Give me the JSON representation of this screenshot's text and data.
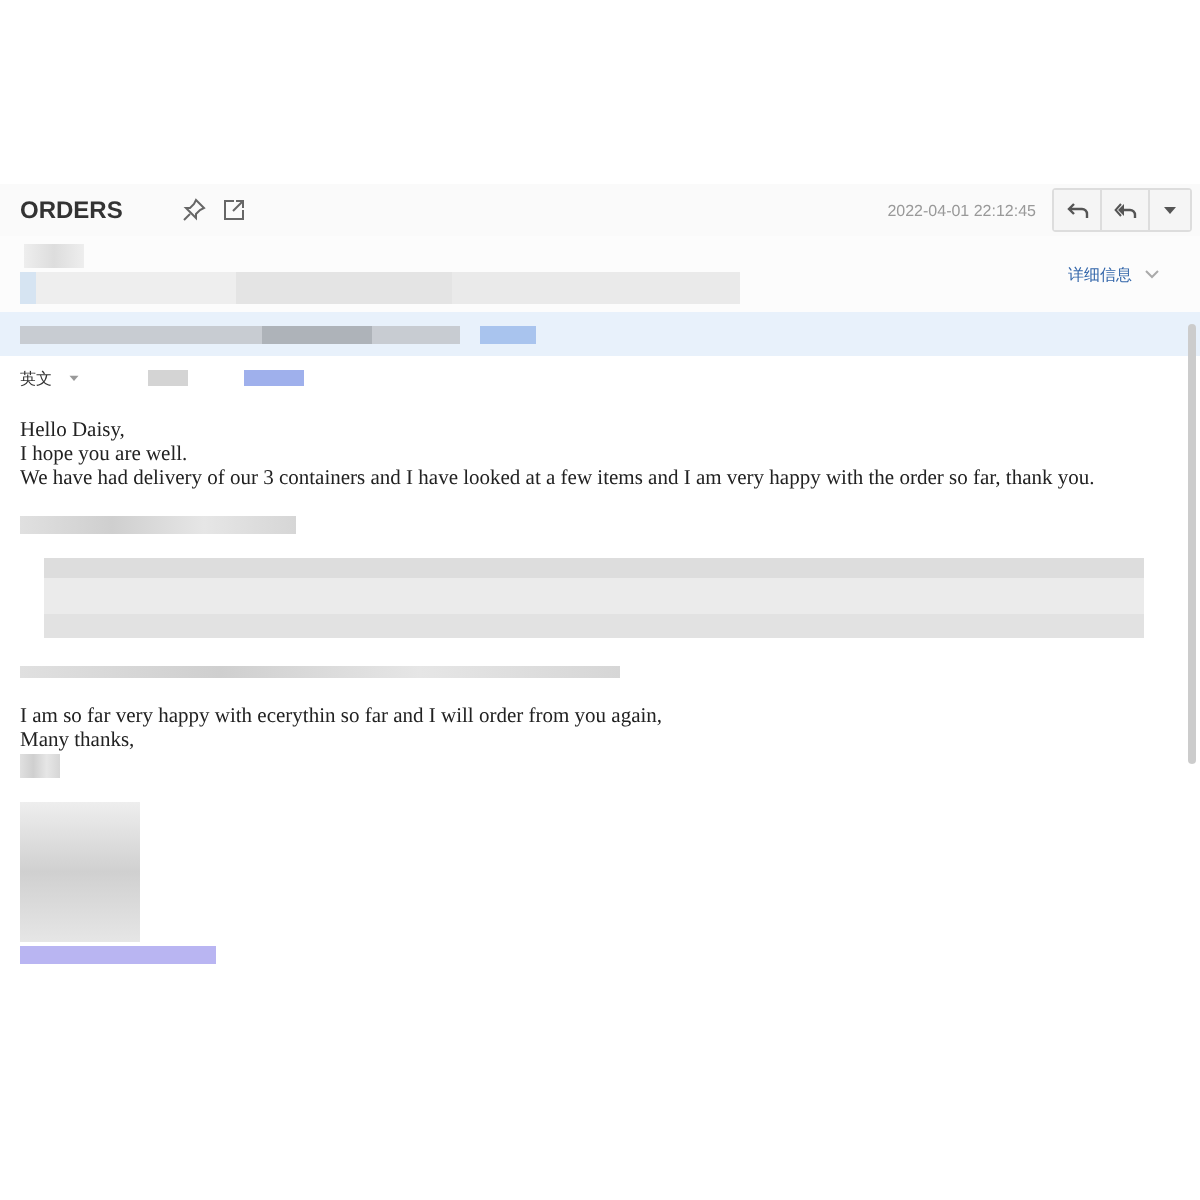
{
  "header": {
    "title": "ORDERS",
    "timestamp": "2022-04-01 22:12:45"
  },
  "details_link": "详细信息",
  "language": {
    "label": "英文"
  },
  "body": {
    "greeting": "Hello Daisy,",
    "lines": [
      "I hope you are well.",
      "We have had delivery of our 3 containers and I have looked at a few items and I am very happy with the order so far, thank you."
    ],
    "closing_lines": [
      "I am so far very happy with ecerythin so far and I will order from you again,",
      "Many thanks,"
    ]
  }
}
